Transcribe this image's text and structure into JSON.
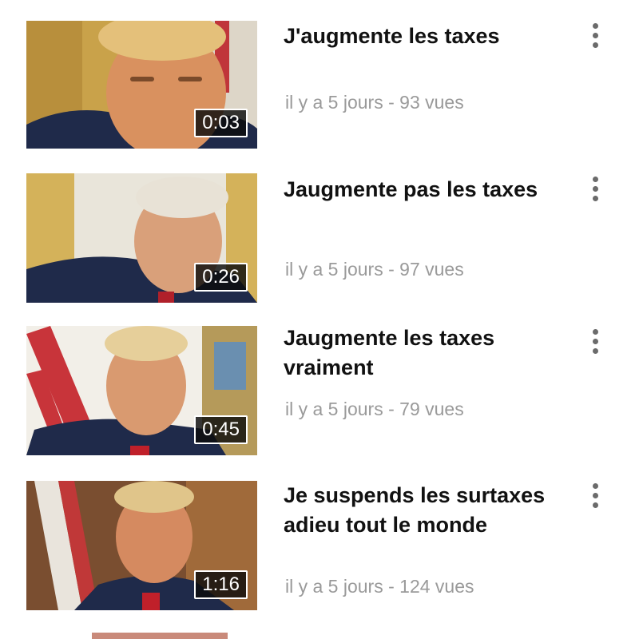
{
  "videos": [
    {
      "title": "J'augmente les taxes",
      "meta": "il y a 5 jours - 93 vues",
      "duration": "0:03",
      "thumbnail_icon": "man-portrait-thumbnail"
    },
    {
      "title": "Jaugmente pas les taxes",
      "meta": "il y a 5 jours - 97 vues",
      "duration": "0:26",
      "thumbnail_icon": "man-portrait-thumbnail"
    },
    {
      "title": "Jaugmente les taxes vraiment",
      "meta": "il y a 5 jours - 79 vues",
      "duration": "0:45",
      "thumbnail_icon": "man-portrait-thumbnail"
    },
    {
      "title": "Je suspends les surtaxes adieu tout le monde",
      "meta": "il y a 5 jours - 124 vues",
      "duration": "1:16",
      "thumbnail_icon": "man-portrait-thumbnail"
    }
  ],
  "more_icon": "vertical-ellipsis-icon"
}
